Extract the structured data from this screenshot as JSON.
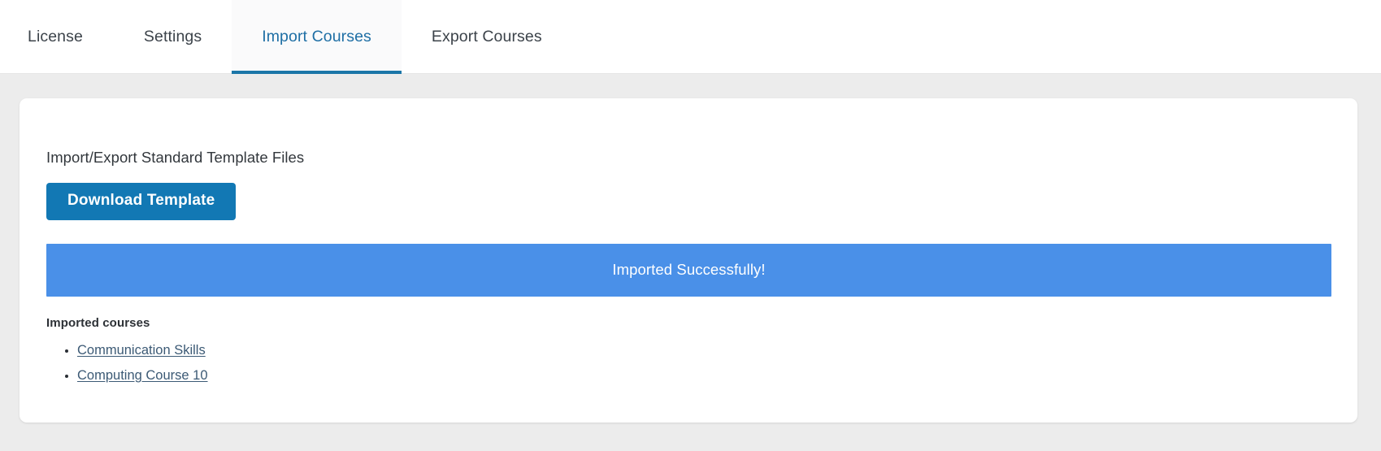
{
  "tabs": [
    {
      "label": "License",
      "active": false
    },
    {
      "label": "Settings",
      "active": false
    },
    {
      "label": "Import Courses",
      "active": true
    },
    {
      "label": "Export Courses",
      "active": false
    }
  ],
  "card": {
    "heading": "Import/Export Standard Template Files",
    "download_button_label": "Download Template",
    "alert": {
      "message": "Imported Successfully!",
      "color": "#4a90e8",
      "text_color": "#ffffff"
    },
    "imported_courses_title": "Imported courses",
    "imported_courses": [
      {
        "label": "Communication Skills"
      },
      {
        "label": "Computing Course 10"
      }
    ]
  },
  "colors": {
    "page_background": "#ececec",
    "tab_active_text": "#1f6fa5",
    "tab_active_underline": "#1b76a8",
    "tab_inactive_text": "#3c434a",
    "button_primary": "#1278b4",
    "link": "#3c5a75",
    "card_background": "#ffffff"
  }
}
